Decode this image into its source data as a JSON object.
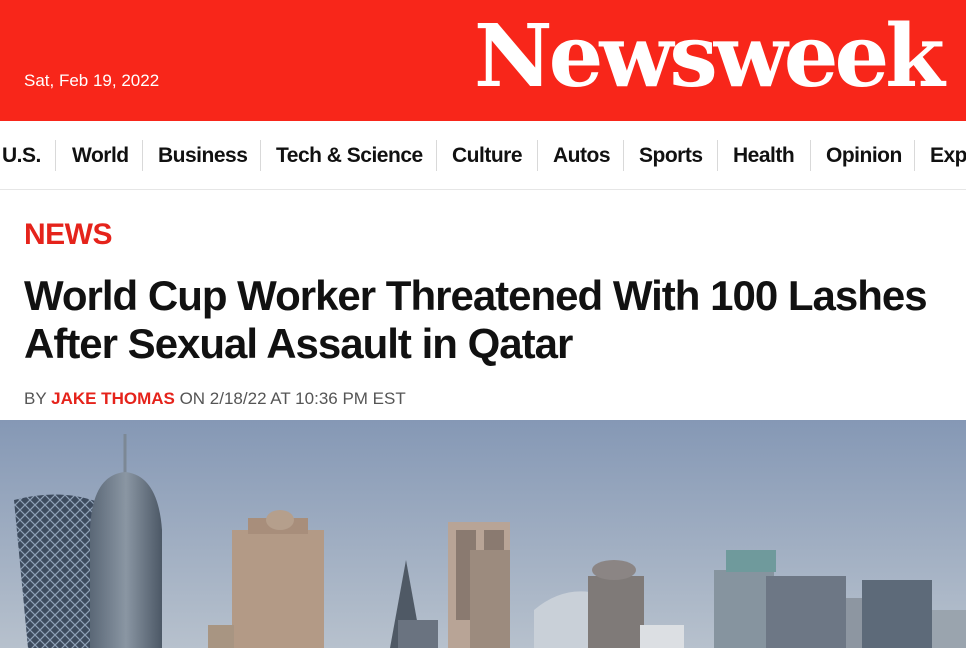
{
  "header": {
    "date": "Sat, Feb 19, 2022",
    "logo": "Newsweek",
    "brand_color": "#f8261a"
  },
  "nav": {
    "items": [
      "U.S.",
      "World",
      "Business",
      "Tech & Science",
      "Culture",
      "Autos",
      "Sports",
      "Health",
      "Opinion",
      "Exp"
    ]
  },
  "article": {
    "kicker": "NEWS",
    "headline": "World Cup Worker Threatened With 100 Lashes After Sexual Assault in Qatar",
    "byline": {
      "prefix": "BY",
      "author": "JAKE THOMAS",
      "suffix": "ON 2/18/22 AT 10:36 PM EST"
    },
    "accent_color": "#e5231b"
  }
}
